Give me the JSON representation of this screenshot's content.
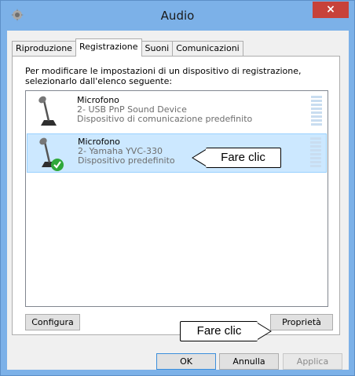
{
  "window": {
    "title": "Audio",
    "close_glyph": "×"
  },
  "tabs": [
    {
      "label": "Riproduzione"
    },
    {
      "label": "Registrazione"
    },
    {
      "label": "Suoni"
    },
    {
      "label": "Comunicazioni"
    }
  ],
  "panel": {
    "instructions_line1": "Per modificare le impostazioni di un dispositivo di registrazione,",
    "instructions_line2": "selezionarlo dall'elenco seguente:"
  },
  "devices": [
    {
      "name": "Microfono",
      "model": "2- USB PnP Sound Device",
      "status": "Dispositivo di comunicazione predefinito",
      "icon": "microphone-icon",
      "selected": false
    },
    {
      "name": "Microfono",
      "model": "2- Yamaha YVC-330",
      "status": "Dispositivo predefinito",
      "icon": "microphone-default-icon",
      "selected": true
    }
  ],
  "callouts": {
    "device": "Fare clic",
    "properties": "Fare clic"
  },
  "buttons": {
    "configure": "Configura",
    "properties": "Proprietà",
    "ok": "OK",
    "cancel": "Annulla",
    "apply": "Applica"
  },
  "colors": {
    "titlebar": "#7cb1e8",
    "close": "#c7423a",
    "selection": "#cce8ff",
    "default_check": "#2fa83a"
  }
}
